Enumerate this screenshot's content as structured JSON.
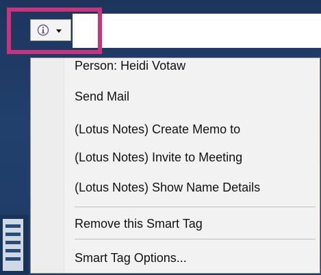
{
  "colors": {
    "background": "#1f3a63",
    "highlight": "#c8337d",
    "menu_bg": "#f2f2f2"
  },
  "smart_tag": {
    "icon": "info-icon",
    "dropdown_icon": "caret-down-icon"
  },
  "menu": {
    "header": "Person: Heidi Votaw",
    "items": [
      {
        "label": "Send Mail"
      },
      {
        "label": "(Lotus Notes) Create Memo to"
      },
      {
        "label": "(Lotus Notes) Invite to Meeting"
      },
      {
        "label": "(Lotus Notes) Show Name Details"
      },
      {
        "label": "Remove this Smart Tag"
      },
      {
        "label": "Smart Tag Options..."
      }
    ]
  }
}
